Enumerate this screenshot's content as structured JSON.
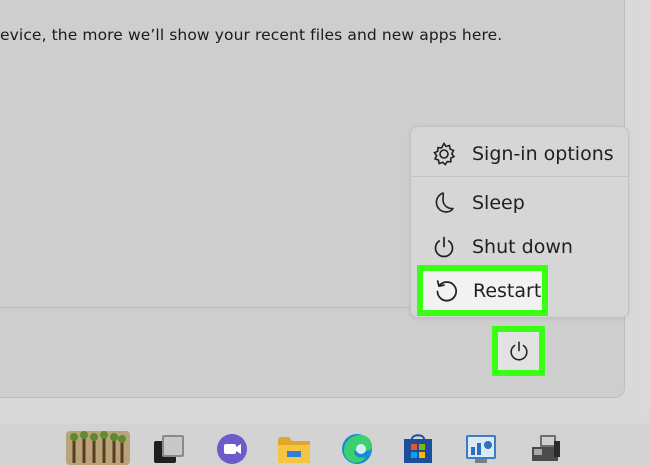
{
  "start_menu": {
    "recommended_message": "evice, the more we’ll show your recent files and new apps here."
  },
  "power_menu": {
    "items": [
      {
        "label": "Sign-in options",
        "icon": "gear-icon"
      },
      {
        "label": "Sleep",
        "icon": "moon-icon"
      },
      {
        "label": "Shut down",
        "icon": "power-icon"
      },
      {
        "label": "Restart",
        "icon": "restart-icon"
      }
    ]
  },
  "highlight_color": "#39ff14",
  "taskbar": {
    "icons": [
      "start-icon",
      "task-view-icon",
      "chat-icon",
      "file-explorer-icon",
      "edge-icon",
      "store-icon",
      "control-panel-icon",
      "devices-icon"
    ]
  }
}
